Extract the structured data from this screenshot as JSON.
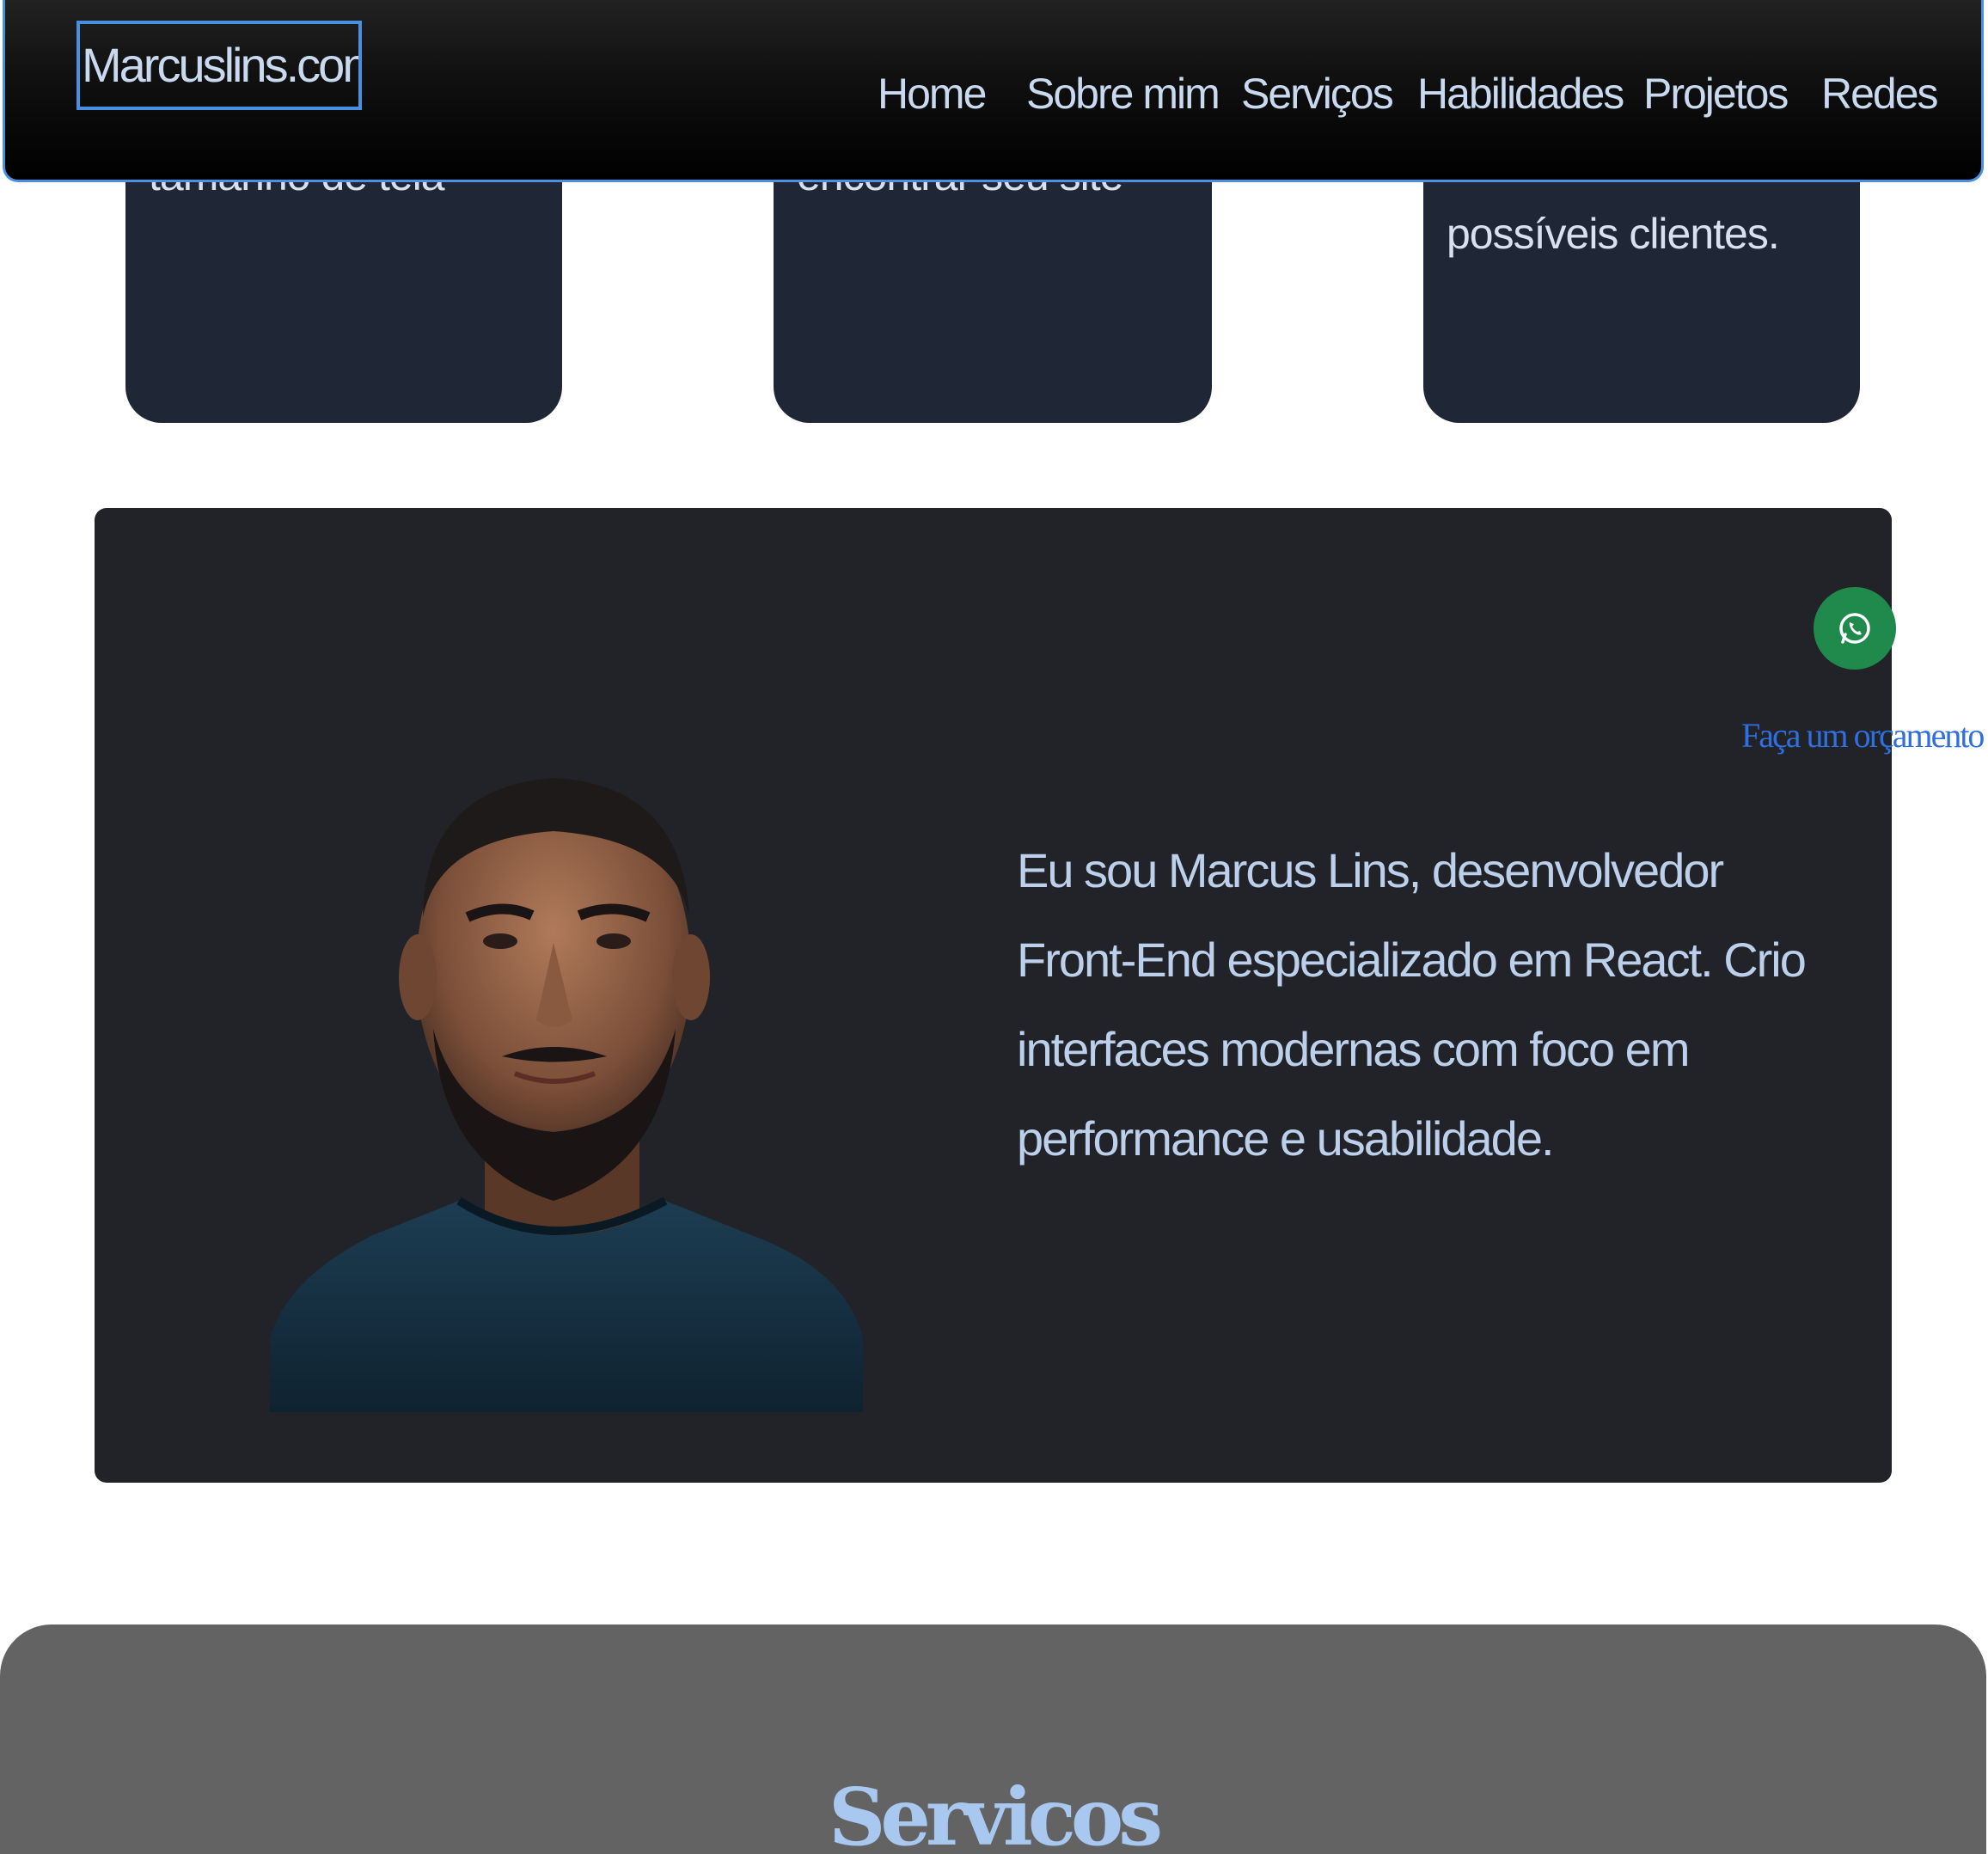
{
  "header": {
    "brand": "Marcuslins.com.br",
    "nav": [
      "Home",
      "Sobre mim",
      "Serviços",
      "Habilidades",
      "Projetos",
      "Redes"
    ]
  },
  "cards": [
    {
      "text": "tamanho de tela"
    },
    {
      "text": "encontrar seu site"
    },
    {
      "text": "Ajuda a transformar visitantes em possíveis clientes."
    }
  ],
  "about": {
    "text": "Eu sou Marcus Lins, desenvolvedor Front-End especializado em React. Crio interfaces modernas com foco em performance e usabilidade."
  },
  "whatsapp": {
    "label": "Faça um orçamento",
    "icon": "whatsapp-icon"
  },
  "services": {
    "title": "Servicos"
  },
  "colors": {
    "accent": "#4a90e2",
    "card_bg": "#1f2636",
    "about_bg": "#212328",
    "whatsapp_green": "#1f8a4c",
    "services_bg": "#636363"
  }
}
